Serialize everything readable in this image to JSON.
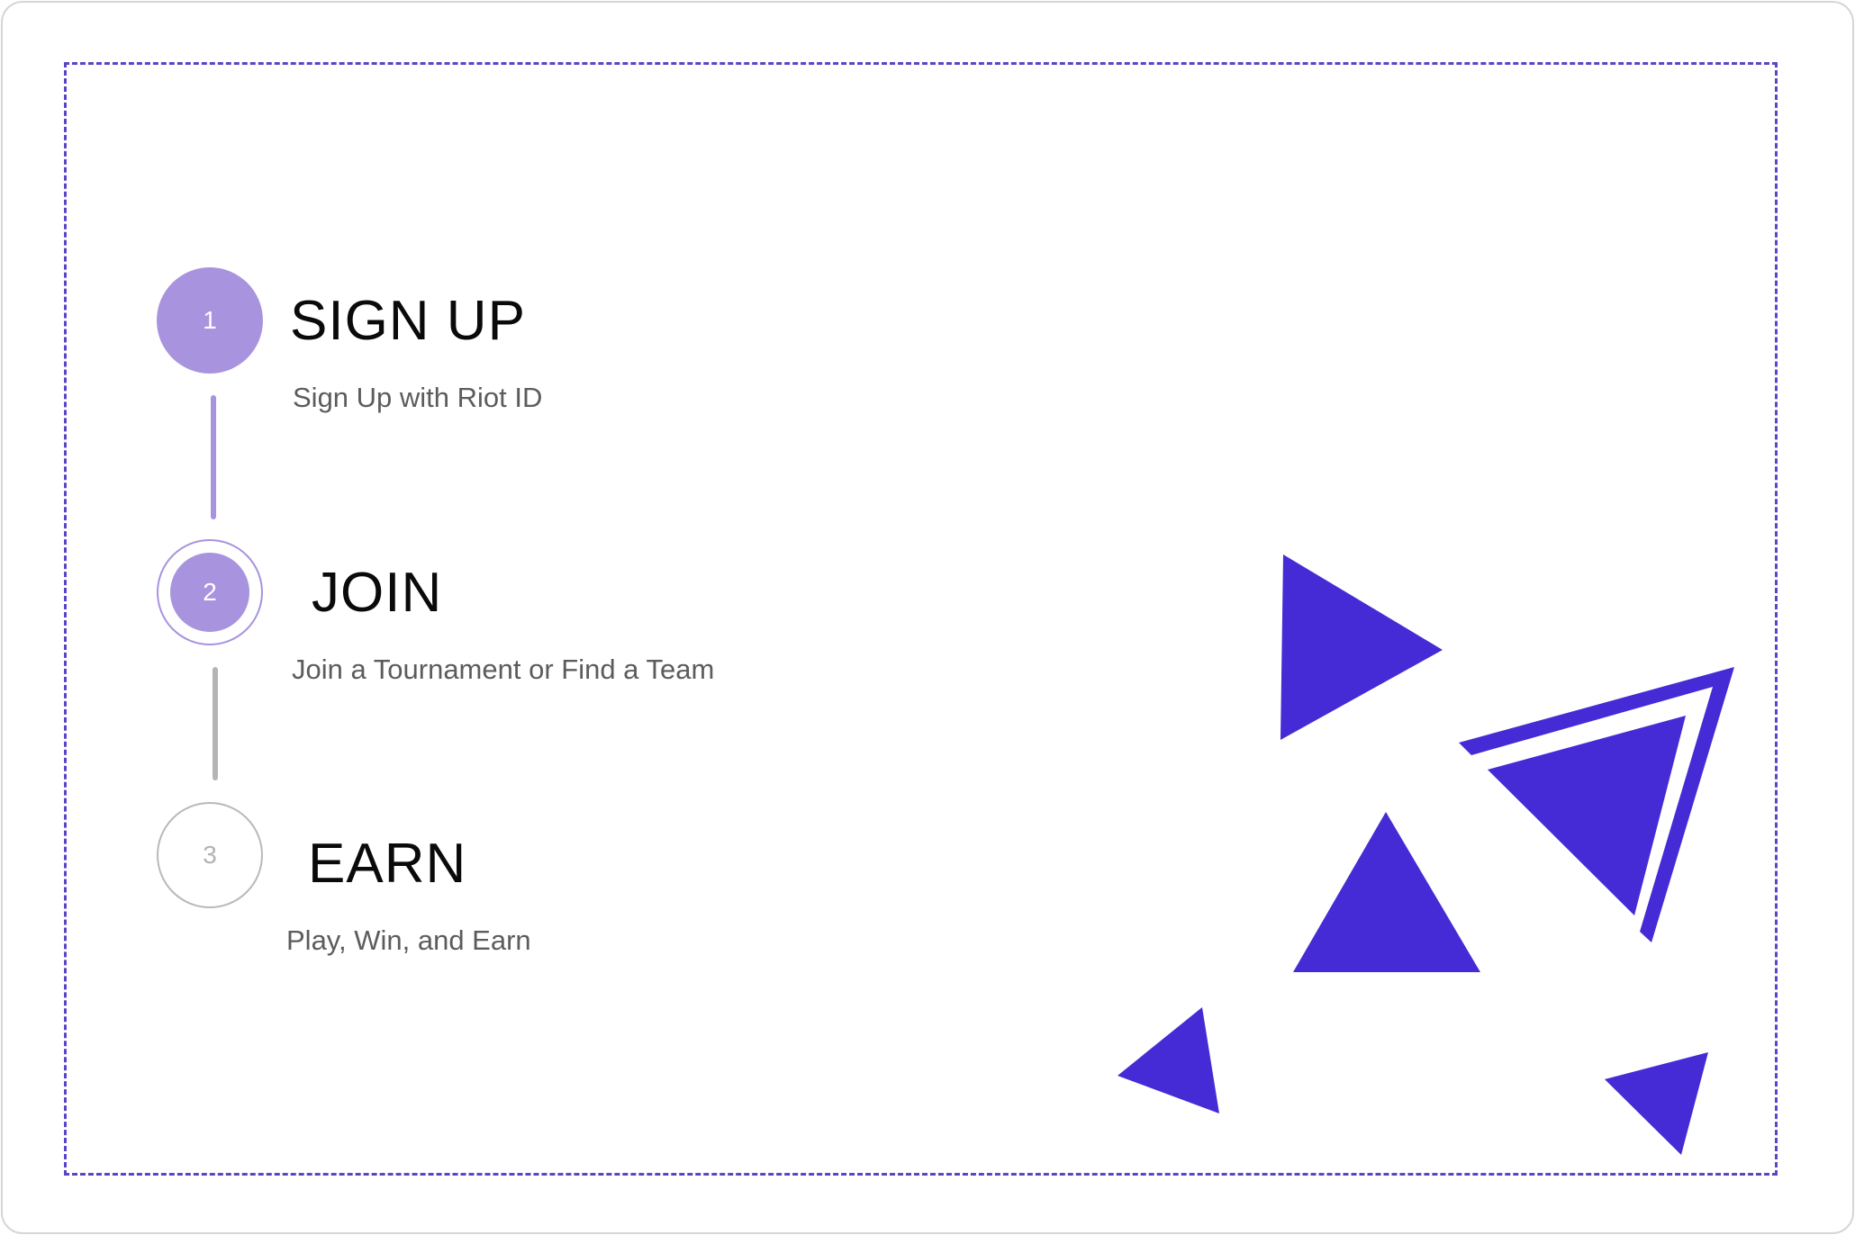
{
  "steps": [
    {
      "number": "1",
      "title": "SIGN UP",
      "description": "Sign Up with Riot ID",
      "state": "completed"
    },
    {
      "number": "2",
      "title": "JOIN",
      "description": "Join a Tournament or Find a Team",
      "state": "current"
    },
    {
      "number": "3",
      "title": "EARN",
      "description": "Play, Win, and Earn",
      "state": "pending"
    }
  ],
  "colors": {
    "accent": "#a893de",
    "frame": "#5a45c8",
    "shapes": "#452bd5",
    "pending": "#b5b5b5"
  }
}
